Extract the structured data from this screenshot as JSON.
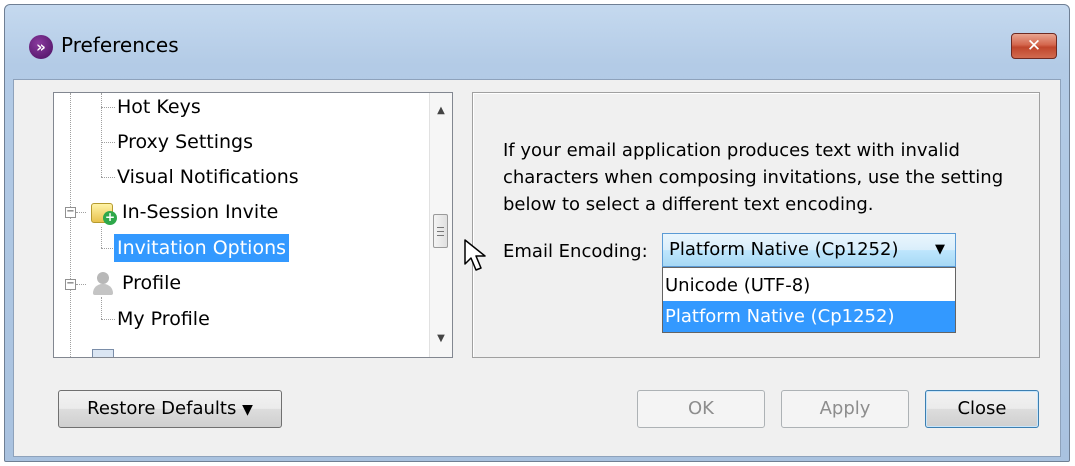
{
  "window": {
    "title": "Preferences",
    "close_glyph": "✕"
  },
  "tree": {
    "items": [
      {
        "label": "Hot Keys"
      },
      {
        "label": "Proxy Settings"
      },
      {
        "label": "Visual Notifications"
      },
      {
        "label": "In-Session Invite",
        "icon": "invite-icon",
        "expanded": true
      },
      {
        "label": "Invitation Options",
        "selected": true
      },
      {
        "label": "Profile",
        "icon": "profile-icon",
        "expanded": true
      },
      {
        "label": "My Profile"
      }
    ]
  },
  "settings": {
    "description": "If your email application produces text with invalid characters when composing invitations, use the setting below to select a different text encoding.",
    "encoding_label": "Email Encoding:",
    "encoding_value": "Platform Native (Cp1252)",
    "encoding_options": [
      {
        "label": "Unicode (UTF-8)",
        "highlighted": false
      },
      {
        "label": "Platform Native (Cp1252)",
        "highlighted": true
      }
    ]
  },
  "buttons": {
    "restore_defaults": "Restore Defaults",
    "restore_arrow": "▼",
    "ok": "OK",
    "apply": "Apply",
    "close": "Close"
  },
  "colors": {
    "selection": "#3399ff",
    "title_bar": "#b9cfe9",
    "close_button": "#c9523a"
  }
}
